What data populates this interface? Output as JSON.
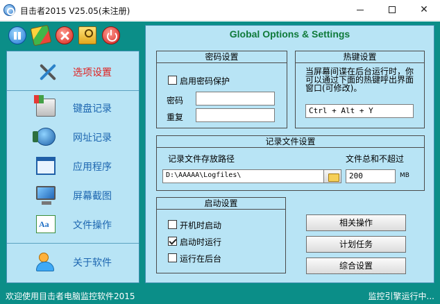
{
  "window": {
    "title": "目击者2015 V25.05(未注册)",
    "controls": {
      "minimize": "—",
      "maximize": "☐",
      "close": "✕"
    }
  },
  "toolbar": {
    "buttons": [
      {
        "name": "pause",
        "icon": "pause-icon"
      },
      {
        "name": "skin",
        "icon": "skin-icon"
      },
      {
        "name": "stop",
        "icon": "stop-icon"
      },
      {
        "name": "keys",
        "icon": "keys-icon"
      },
      {
        "name": "power",
        "icon": "power-icon"
      }
    ]
  },
  "sidebar": {
    "items": [
      {
        "label": "选项设置",
        "icon": "tools-icon",
        "active": true
      },
      {
        "label": "键盘记录",
        "icon": "keyboard-icon",
        "active": false
      },
      {
        "label": "网址记录",
        "icon": "globe-icon",
        "active": false
      },
      {
        "label": "应用程序",
        "icon": "window-icon",
        "active": false
      },
      {
        "label": "屏幕截图",
        "icon": "monitor-icon",
        "active": false
      },
      {
        "label": "文件操作",
        "icon": "files-icon",
        "active": false
      },
      {
        "label": "关于软件",
        "icon": "users-icon",
        "active": false
      }
    ]
  },
  "main": {
    "title": "Global Options & Settings",
    "password": {
      "title": "密码设置",
      "enable_label": "启用密码保护",
      "enable_checked": false,
      "password_label": "密码",
      "password_value": "",
      "repeat_label": "重复",
      "repeat_value": ""
    },
    "hotkey": {
      "title": "热键设置",
      "description": "当屏幕间谍在后台运行时，你可以通过下面的热键呼出界面窗口(可修改)。",
      "value": "Ctrl + Alt + Y"
    },
    "logfile": {
      "title": "记录文件设置",
      "path_label": "记录文件存放路径",
      "path_value": "D:\\AAAAA\\Logfiles\\",
      "size_label": "文件总和不超过",
      "size_value": "200",
      "size_unit": "MB"
    },
    "startup": {
      "title": "启动设置",
      "options": [
        {
          "label": "开机时启动",
          "checked": false
        },
        {
          "label": "启动时运行",
          "checked": true
        },
        {
          "label": "运行在后台",
          "checked": false
        }
      ]
    },
    "actions": {
      "related": "相关操作",
      "schedule": "计划任务",
      "general": "综合设置"
    }
  },
  "status": {
    "left": "欢迎使用目击者电脑监控软件2015",
    "right": "监控引擎运行中..."
  },
  "colors": {
    "window_bg": "#0b8e88",
    "panel_bg": "#b8e4f5",
    "accent_title": "#0f7a3a",
    "nav_label": "#1d66b0",
    "nav_active": "#e02020"
  }
}
